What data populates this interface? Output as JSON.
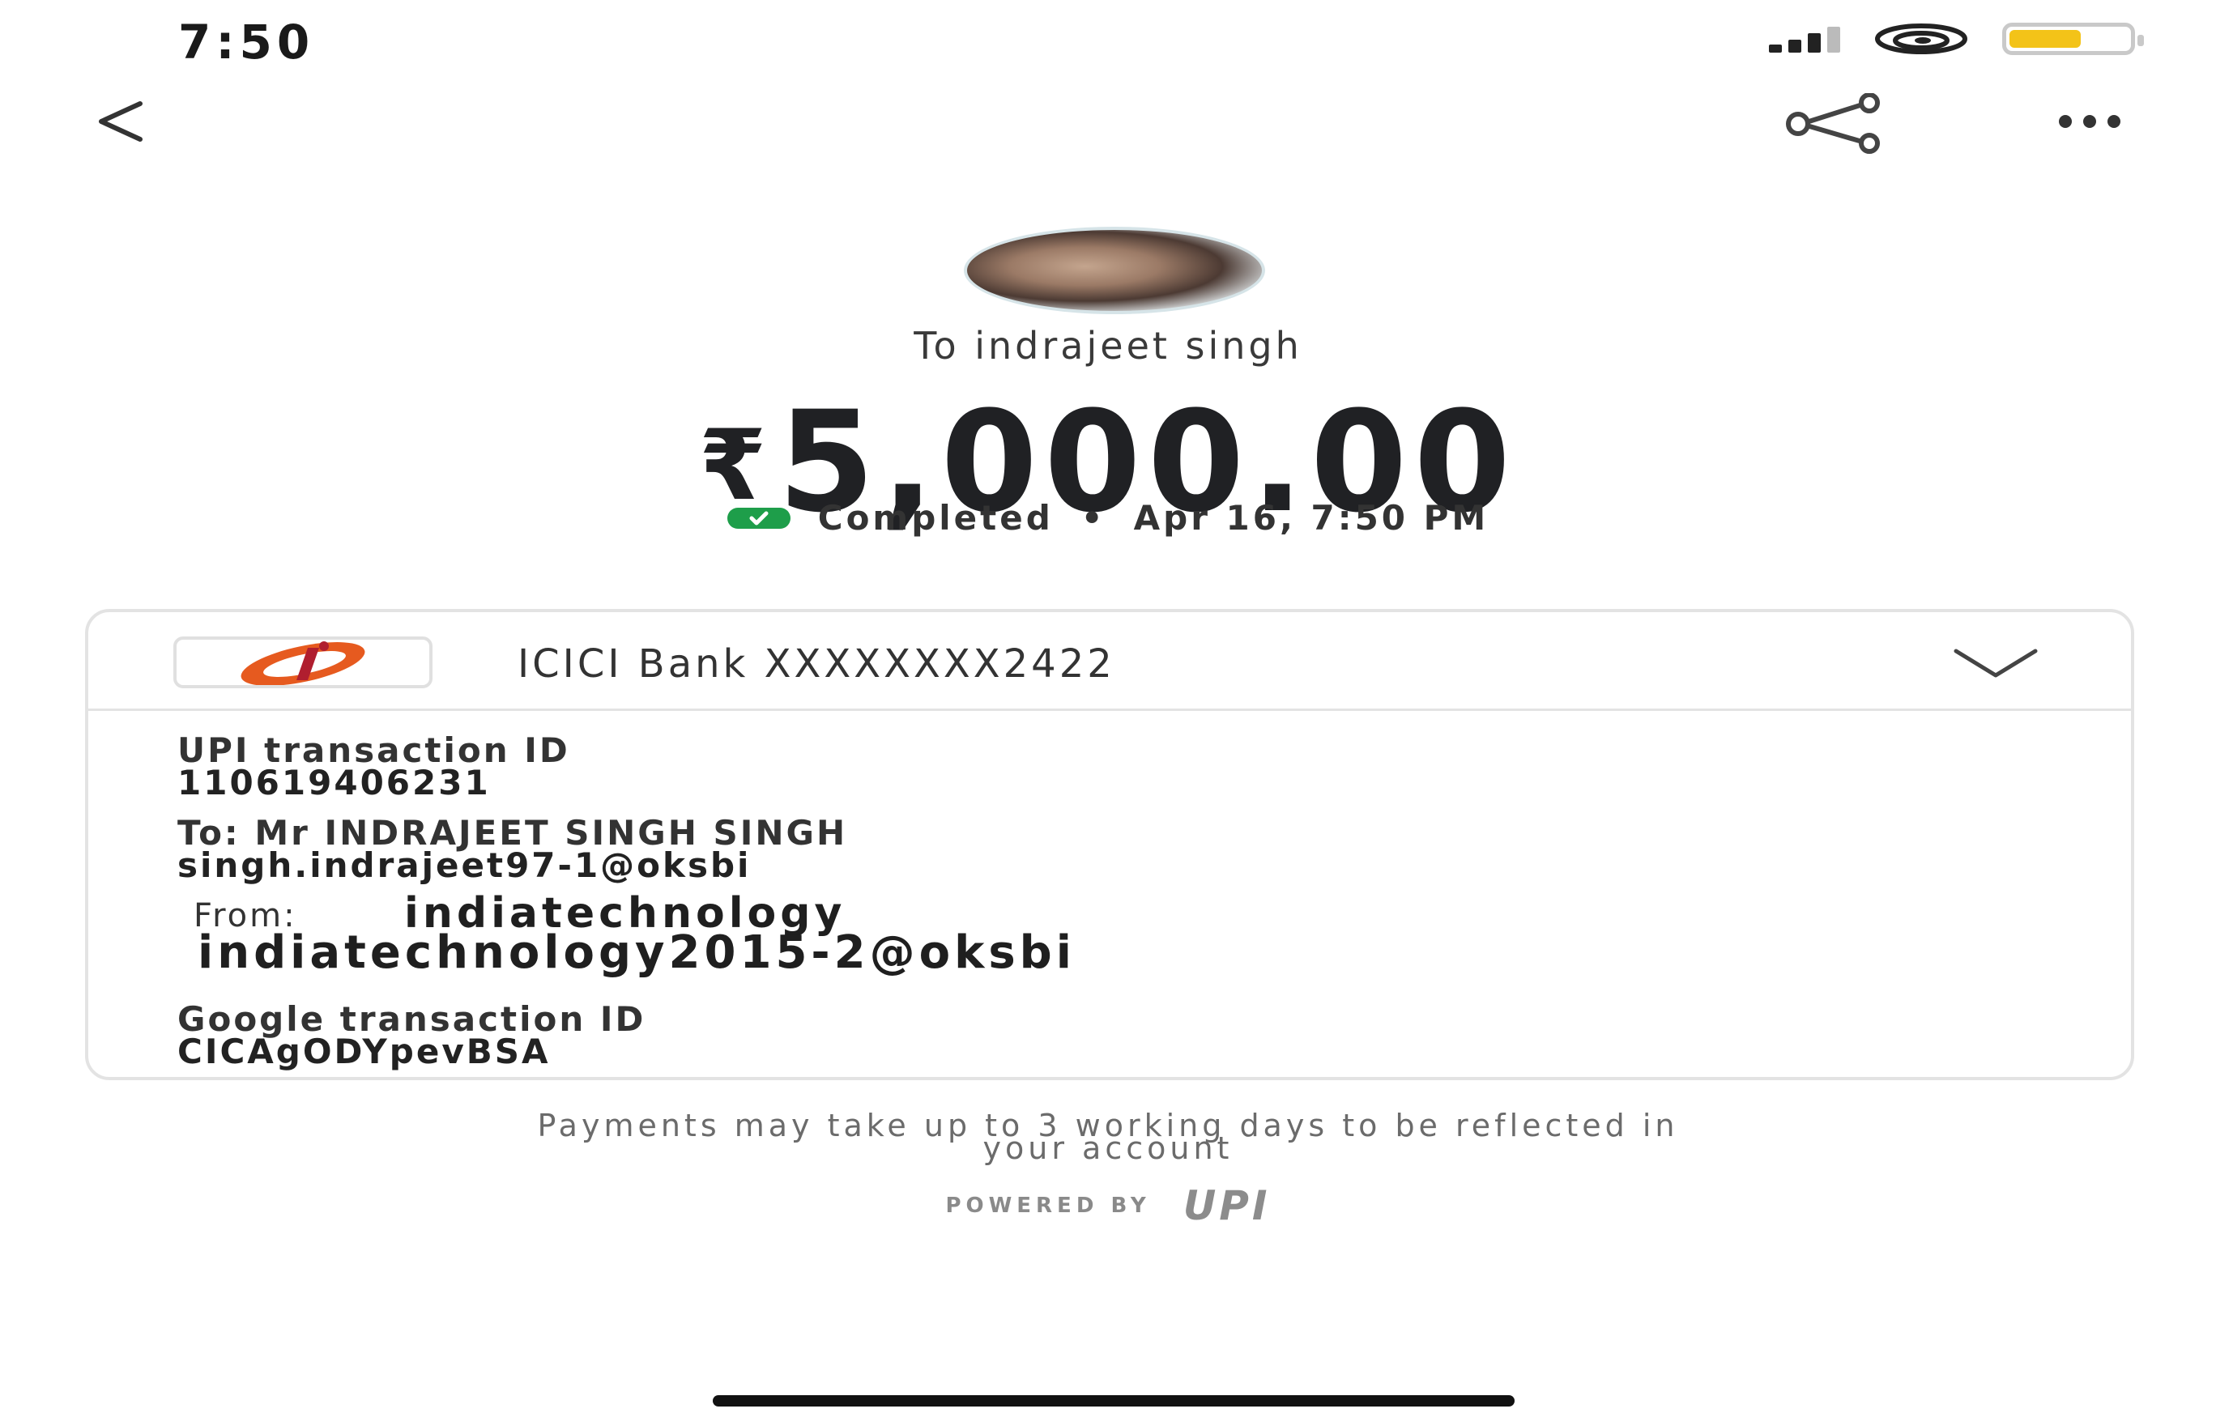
{
  "status_bar": {
    "time": "7:50",
    "battery_level": 0.6,
    "battery_color": "#f3c318"
  },
  "app_bar": {
    "back_icon": "chevron-left-icon",
    "share_icon": "share-icon",
    "more_icon": "more-horizontal-icon"
  },
  "header": {
    "recipient": "To indrajeet singh",
    "currency_symbol": "₹",
    "amount": "5,000.00",
    "status": "Completed",
    "separator": "•",
    "datetime": "Apr 16, 7:50 PM",
    "status_color": "#1e9e4a"
  },
  "card": {
    "bank_name": "ICICI Bank XXXXXXXX2422",
    "bank_logo_colors": [
      "#e65a1f",
      "#b01e2f"
    ],
    "upi_txn_label": "UPI transaction ID",
    "upi_txn_id": "110619406231",
    "to_line": "To: Mr INDRAJEET SINGH  SINGH",
    "to_vpa": "singh.indrajeet97-1@oksbi",
    "from_label": "From:",
    "from_name": "indiatechnology",
    "from_vpa": "indiatechnology2015-2@oksbi",
    "google_txn_label": "Google transaction ID",
    "google_txn_id": "CICAgODYpevBSA"
  },
  "footer": {
    "note_line1": "Payments may take up to 3 working days to be reflected in",
    "note_line2": "your account",
    "powered_by": "POWERED BY",
    "upi_logo_text": "UPI"
  }
}
